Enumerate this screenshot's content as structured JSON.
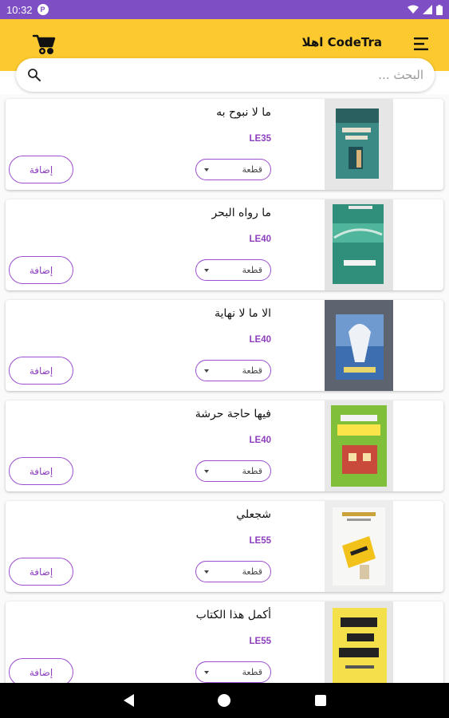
{
  "status_bar": {
    "time": "10:32",
    "app_badge": "P",
    "icons": [
      "wifi-icon",
      "signal-icon",
      "battery-icon"
    ]
  },
  "header": {
    "greeting": "اهلا CodeTra",
    "background": "#fcca2e",
    "icons": [
      "cart-icon",
      "menu-icon"
    ]
  },
  "search": {
    "placeholder": "البحث ..."
  },
  "colors": {
    "status_bar": "#7e4fc4",
    "accent_purple": "#8e3fbf",
    "header_yellow": "#fcca2e"
  },
  "products": [
    {
      "title": "ما لا نبوح به",
      "price": "LE35",
      "unit_label": "قطعة",
      "add_label": "إضافة"
    },
    {
      "title": "ما رواه البحر",
      "price": "LE40",
      "unit_label": "قطعة",
      "add_label": "إضافة"
    },
    {
      "title": "الا ما لا نهاية",
      "price": "LE40",
      "unit_label": "قطعة",
      "add_label": "إضافة"
    },
    {
      "title": "فيها حاجة حرشة",
      "price": "LE40",
      "unit_label": "قطعة",
      "add_label": "إضافة"
    },
    {
      "title": "شجعلي",
      "price": "LE55",
      "unit_label": "قطعة",
      "add_label": "إضافة"
    },
    {
      "title": "أكمل هذا الكتاب",
      "price": "LE55",
      "unit_label": "قطعة",
      "add_label": "إضافة"
    }
  ],
  "nav_bar": {
    "icons": [
      "back-icon",
      "home-icon",
      "recents-icon"
    ]
  }
}
